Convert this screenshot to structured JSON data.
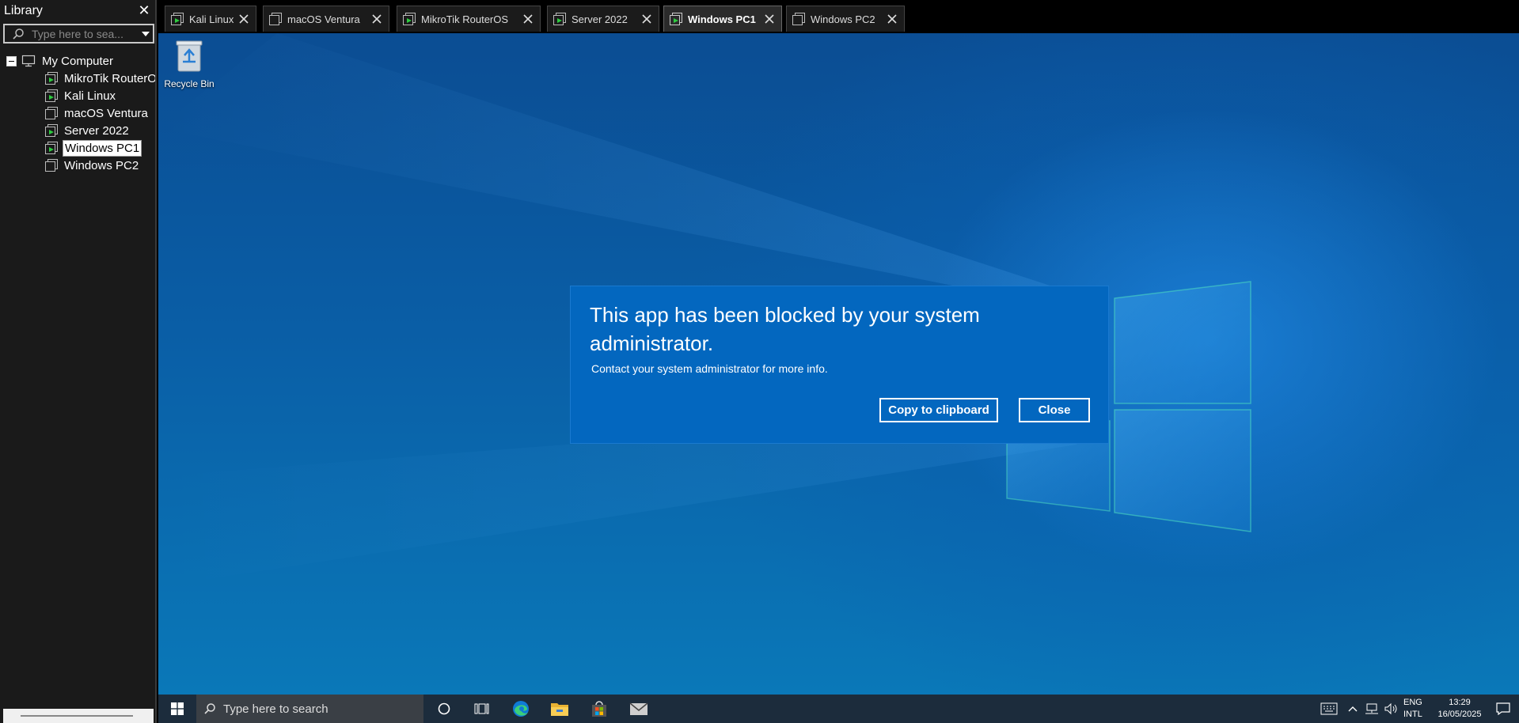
{
  "library": {
    "title": "Library",
    "search_placeholder": "Type here to sea...",
    "root_label": "My Computer",
    "items": [
      {
        "label": "MikroTik RouterOS",
        "running": true
      },
      {
        "label": "Kali Linux",
        "running": true
      },
      {
        "label": "macOS Ventura",
        "running": false
      },
      {
        "label": "Server 2022",
        "running": true
      },
      {
        "label": "Windows PC1",
        "running": true,
        "selected": true
      },
      {
        "label": "Windows PC2",
        "running": false
      }
    ]
  },
  "tabs": [
    {
      "label": "Kali Linux",
      "running": true
    },
    {
      "label": "macOS Ventura",
      "running": false
    },
    {
      "label": "MikroTik RouterOS",
      "running": true
    },
    {
      "label": "Server 2022",
      "running": true
    },
    {
      "label": "Windows PC1",
      "running": true,
      "active": true
    },
    {
      "label": "Windows PC2",
      "running": false
    }
  ],
  "desktop": {
    "recycle_bin_label": "Recycle Bin"
  },
  "dialog": {
    "title": "This app has been blocked by your system administrator.",
    "message": "Contact your system administrator for more info.",
    "copy_label": "Copy to clipboard",
    "close_label": "Close"
  },
  "taskbar": {
    "search_placeholder": "Type here to search",
    "lang_line1": "ENG",
    "lang_line2": "INTL",
    "time": "13:29",
    "date": "16/05/2025"
  },
  "colors": {
    "dialog_bg": "#0367bf",
    "vm_running": "#2ecc40",
    "taskbar_bg": "#1c2c3c"
  }
}
